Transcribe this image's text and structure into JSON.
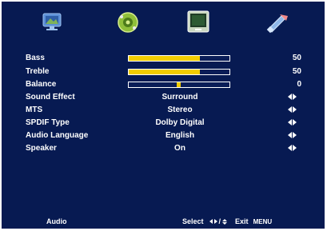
{
  "tabs": [
    {
      "icon": "picture-icon"
    },
    {
      "icon": "audio-icon"
    },
    {
      "icon": "timer-icon"
    },
    {
      "icon": "setup-icon"
    }
  ],
  "settings": {
    "bass": {
      "label": "Bass",
      "value": 50,
      "display": "50"
    },
    "treble": {
      "label": "Treble",
      "value": 50,
      "display": "50"
    },
    "balance": {
      "label": "Balance",
      "value": 0,
      "display": "0"
    },
    "sound_effect": {
      "label": "Sound Effect",
      "value": "Surround"
    },
    "mts": {
      "label": "MTS",
      "value": "Stereo"
    },
    "spdif_type": {
      "label": "SPDIF Type",
      "value": "Dolby Digital"
    },
    "audio_language": {
      "label": "Audio Language",
      "value": "English"
    },
    "speaker": {
      "label": "Speaker",
      "value": "On"
    }
  },
  "footer": {
    "menu_title": "Audio",
    "select_label": "Select",
    "slash": "/",
    "exit_label": "Exit",
    "menu_key": "MENU"
  },
  "colors": {
    "background": "#071a52",
    "bar_fill": "#f2cd00"
  }
}
